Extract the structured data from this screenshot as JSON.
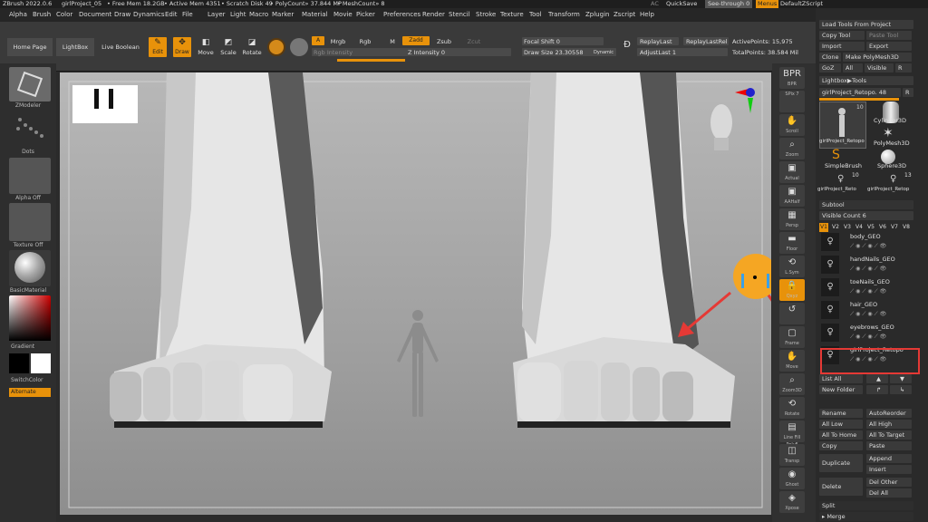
{
  "titlebar": {
    "app": "ZBrush 2022.0.6",
    "project": "girlProject_05",
    "free_mem": "• Free Mem 18.2GB",
    "active_mem": "• Active Mem 4351",
    "scratch": "• Scratch Disk 49",
    "polycount": "• PolyCount» 37.844 MP",
    "meshcount": "• MeshCount» 8",
    "ac": "AC",
    "quicksave": "QuickSave",
    "seethrough": "See-through  0",
    "menus": "Menus",
    "default_zscript": "DefaultZScript"
  },
  "menubar": [
    "Alpha",
    "Brush",
    "Color",
    "Document",
    "Draw",
    "Dynamics",
    "Edit",
    "File",
    "Layer",
    "Light",
    "Macro",
    "Marker",
    "Material",
    "Movie",
    "Picker",
    "Preferences",
    "Render",
    "Stencil",
    "Stroke",
    "Texture",
    "Tool",
    "Transform",
    "Zplugin",
    "Zscript",
    "Help"
  ],
  "topbar": {
    "home_page": "Home Page",
    "lightbox": "LightBox",
    "live_boolean": "Live Boolean",
    "edit": "Edit",
    "draw": "Draw",
    "move": "Move",
    "scale": "Scale",
    "rotate": "Rotate",
    "a": "A",
    "mrgb": "Mrgb",
    "rgb": "Rgb",
    "m": "M",
    "zadd": "Zadd",
    "zsub": "Zsub",
    "zcut": "Zcut",
    "rgb_intensity": "Rgb Intensity",
    "z_intensity": "Z Intensity 0",
    "focal_shift": "Focal Shift 0",
    "draw_size": "Draw Size 23.30558",
    "dynamic": "Dynamic",
    "replay_last": "ReplayLast",
    "replay_last_rel": "ReplayLastRel",
    "adjust_last": "AdjustLast 1",
    "active_points": "ActivePoints: 15,975",
    "total_points": "TotalPoints: 38.584 Mil"
  },
  "leftshelf": {
    "zmodeler": "ZModeler",
    "dots": "Dots",
    "alpha_off": "Alpha Off",
    "texture_off": "Texture Off",
    "basic_material": "BasicMaterial",
    "gradient": "Gradient",
    "switch_color": "SwitchColor",
    "alternate": "Alternate"
  },
  "rightshelf": [
    {
      "icon": "BPR",
      "label": "BPR"
    },
    {
      "icon": "",
      "label": "SPix 7"
    },
    {
      "icon": "✋",
      "label": "Scroll"
    },
    {
      "icon": "⌕",
      "label": "Zoom"
    },
    {
      "icon": "▣",
      "label": "Actual"
    },
    {
      "icon": "▣",
      "label": "AAHalf"
    },
    {
      "icon": "▦",
      "label": "Persp"
    },
    {
      "icon": "▬",
      "label": "Floor"
    },
    {
      "icon": "⟲",
      "label": "L.Sym"
    },
    {
      "icon": "🔒",
      "label": "Qxyz"
    },
    {
      "icon": "↺",
      "label": ""
    },
    {
      "icon": "▢",
      "label": "Frame"
    },
    {
      "icon": "✋",
      "label": "Move"
    },
    {
      "icon": "⌕",
      "label": "Zoom3D"
    },
    {
      "icon": "⟲",
      "label": "Rotate"
    },
    {
      "icon": "▤",
      "label": "Line Fill PolyF"
    },
    {
      "icon": "◫",
      "label": "Transp"
    },
    {
      "icon": "◉",
      "label": "Ghost"
    },
    {
      "icon": "◈",
      "label": "Xpose"
    }
  ],
  "tray": {
    "load_tools": "Load Tools From Project",
    "copy_tool": "Copy Tool",
    "paste_tool": "Paste Tool",
    "import": "Import",
    "export": "Export",
    "clone": "Clone",
    "make_polymesh": "Make PolyMesh3D",
    "goz": "GoZ",
    "all": "All",
    "visible": "Visible",
    "r": "R",
    "lightbox_tools": "Lightbox▶Tools",
    "current_tool": "girlProject_Retopo. 48",
    "tool_count_1": "10",
    "tool_1": "girlProject_Retopo",
    "tool_2": "Cylinder3D",
    "tool_3": "PolyMesh3D",
    "tool_4": "SimpleBrush",
    "tool_5": "Sphere3D",
    "tool_count_6": "10",
    "tool_count_7": "13",
    "tool_6": "girlProject_Reto",
    "tool_7": "girlProject_Retop",
    "subtool": "Subtool",
    "visible_count": "Visible Count 6",
    "versions": [
      "V1",
      "V2",
      "V3",
      "V4",
      "V5",
      "V6",
      "V7",
      "V8"
    ],
    "subtools": [
      "body_GEO",
      "handNails_GEO",
      "toeNails_GEO",
      "hair_GEO",
      "eyebrows_GEO",
      "girlProject_Retopo"
    ],
    "list_all": "List All",
    "new_folder": "New Folder",
    "rename": "Rename",
    "auto_reorder": "AutoReorder",
    "all_low": "All Low",
    "all_high": "All High",
    "all_to_home": "All To Home",
    "all_to_target": "All To Target",
    "copy": "Copy",
    "paste": "Paste",
    "duplicate": "Duplicate",
    "append": "Append",
    "insert": "Insert",
    "delete": "Delete",
    "del_other": "Del Other",
    "del_all": "Del All",
    "split": "Split",
    "merge": "▸ Merge"
  },
  "colors": {
    "accent": "#e8920a",
    "annotation": "#e53935",
    "highlight_box": "#e53935",
    "emoji": "#f5a623"
  }
}
